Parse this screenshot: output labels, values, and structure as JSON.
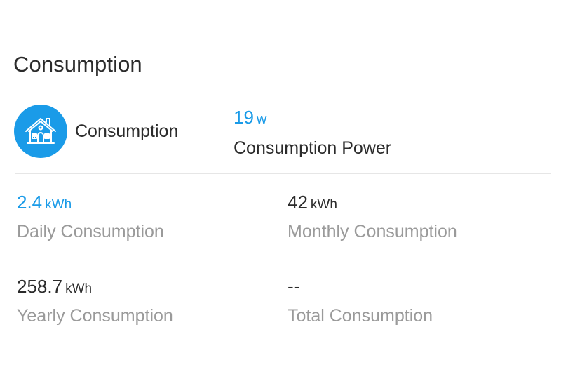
{
  "section": {
    "title": "Consumption"
  },
  "summary": {
    "icon": "house-icon",
    "label": "Consumption",
    "power_value": "19",
    "power_unit": "w",
    "power_label": "Consumption Power"
  },
  "stats": [
    {
      "value": "2.4",
      "unit": "kWh",
      "label": "Daily Consumption"
    },
    {
      "value": "42",
      "unit": "kWh",
      "label": "Monthly Consumption"
    },
    {
      "value": "258.7",
      "unit": "kWh",
      "label": "Yearly Consumption"
    },
    {
      "value": "--",
      "unit": "",
      "label": "Total Consumption"
    }
  ],
  "colors": {
    "accent": "#1a9be8",
    "text": "#2b2b2b",
    "muted": "#9a9a9a",
    "divider": "#e6e6e6"
  }
}
